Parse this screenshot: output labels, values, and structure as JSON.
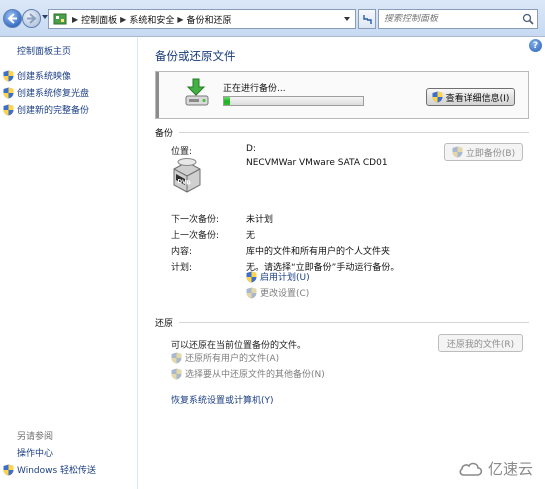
{
  "address_bar": {
    "breadcrumbs": [
      "控制面板",
      "系统和安全",
      "备份和还原"
    ],
    "search_placeholder": "搜索控制面板"
  },
  "left_pane": {
    "home_link": "控制面板主页",
    "tasks": [
      "创建系统映像",
      "创建系统修复光盘",
      "创建新的完整备份"
    ],
    "see_also_heading": "另请参阅",
    "see_also": [
      "操作中心",
      "Windows 轻松传送"
    ]
  },
  "main": {
    "title": "备份或还原文件",
    "progress": {
      "status_text": "正在进行备份...",
      "fraction": 0.04,
      "details_button": "查看详细信息(I)"
    },
    "backup": {
      "heading": "备份",
      "location_label": "位置:",
      "location_drive": "D:",
      "location_device": "NECVMWar VMware SATA CD01",
      "backup_now_button": "立即备份(B)",
      "dvd_label": "DVD",
      "next_label": "下一次备份:",
      "next_value": "未计划",
      "last_label": "上一次备份:",
      "last_value": "无",
      "contents_label": "内容:",
      "contents_value": "库中的文件和所有用户的个人文件夹",
      "schedule_label": "计划:",
      "schedule_value": "无。请选择“立即备份”手动运行备份。",
      "turn_on_schedule": "启用计划(U)",
      "change_settings": "更改设置(C)"
    },
    "restore": {
      "heading": "还原",
      "description": "可以还原在当前位置备份的文件。",
      "restore_my_files_button": "还原我的文件(R)",
      "restore_all_users": "还原所有用户的文件(A)",
      "select_other_backup": "选择要从中还原文件的其他备份(N)",
      "recover_settings": "恢复系统设置或计算机(Y)"
    }
  },
  "watermark": {
    "text": "亿速云"
  },
  "colors": {
    "link": "#1c3f84",
    "title": "#1a3b7a",
    "progress_fill": "#1fae1f"
  }
}
